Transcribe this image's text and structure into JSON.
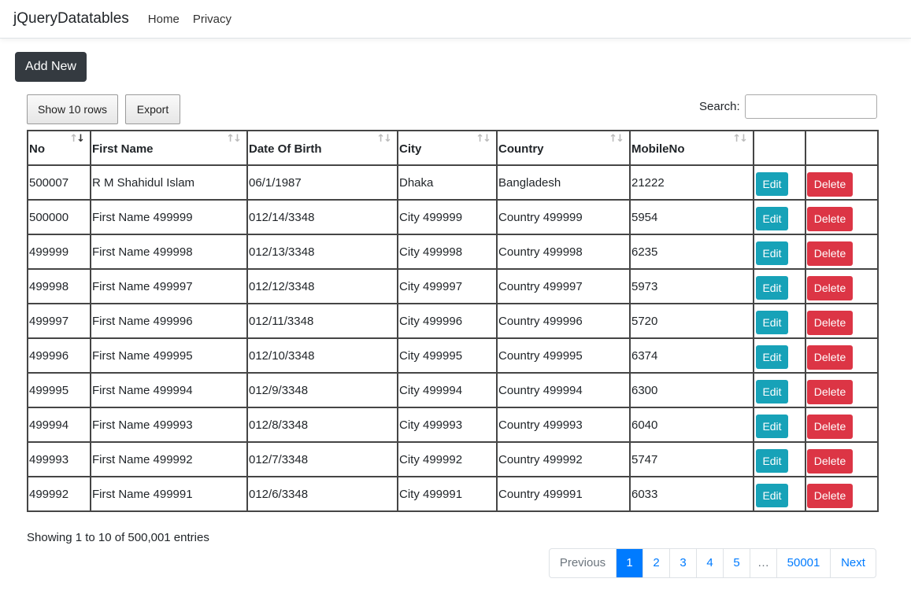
{
  "navbar": {
    "brand": "jQueryDatatables",
    "links": [
      "Home",
      "Privacy"
    ]
  },
  "add_button": "Add New",
  "toolbar": {
    "rows_button": "Show 10 rows",
    "export_button": "Export",
    "search_label": "Search:",
    "search_value": ""
  },
  "table": {
    "columns": [
      "No",
      "First Name",
      "Date Of Birth",
      "City",
      "Country",
      "MobileNo",
      "",
      ""
    ],
    "rows": [
      [
        "500007",
        "R M Shahidul Islam",
        "06/1/1987",
        "Dhaka",
        "Bangladesh",
        "21222"
      ],
      [
        "500000",
        "First Name 499999",
        "012/14/3348",
        "City 499999",
        "Country 499999",
        "5954"
      ],
      [
        "499999",
        "First Name 499998",
        "012/13/3348",
        "City 499998",
        "Country 499998",
        "6235"
      ],
      [
        "499998",
        "First Name 499997",
        "012/12/3348",
        "City 499997",
        "Country 499997",
        "5973"
      ],
      [
        "499997",
        "First Name 499996",
        "012/11/3348",
        "City 499996",
        "Country 499996",
        "5720"
      ],
      [
        "499996",
        "First Name 499995",
        "012/10/3348",
        "City 499995",
        "Country 499995",
        "6374"
      ],
      [
        "499995",
        "First Name 499994",
        "012/9/3348",
        "City 499994",
        "Country 499994",
        "6300"
      ],
      [
        "499994",
        "First Name 499993",
        "012/8/3348",
        "City 499993",
        "Country 499993",
        "6040"
      ],
      [
        "499993",
        "First Name 499992",
        "012/7/3348",
        "City 499992",
        "Country 499992",
        "5747"
      ],
      [
        "499992",
        "First Name 499991",
        "012/6/3348",
        "City 499991",
        "Country 499991",
        "6033"
      ]
    ],
    "edit_label": "Edit",
    "delete_label": "Delete"
  },
  "info": "Showing 1 to 10 of 500,001 entries",
  "pagination": {
    "previous": "Previous",
    "pages": [
      "1",
      "2",
      "3",
      "4",
      "5",
      "…",
      "50001"
    ],
    "active": "1",
    "next": "Next"
  },
  "colors": {
    "edit": "#17a2b8",
    "delete": "#dc3545",
    "primary": "#007bff",
    "dark": "#343a40"
  },
  "icons": {
    "sort": "sort-arrows-icon"
  }
}
